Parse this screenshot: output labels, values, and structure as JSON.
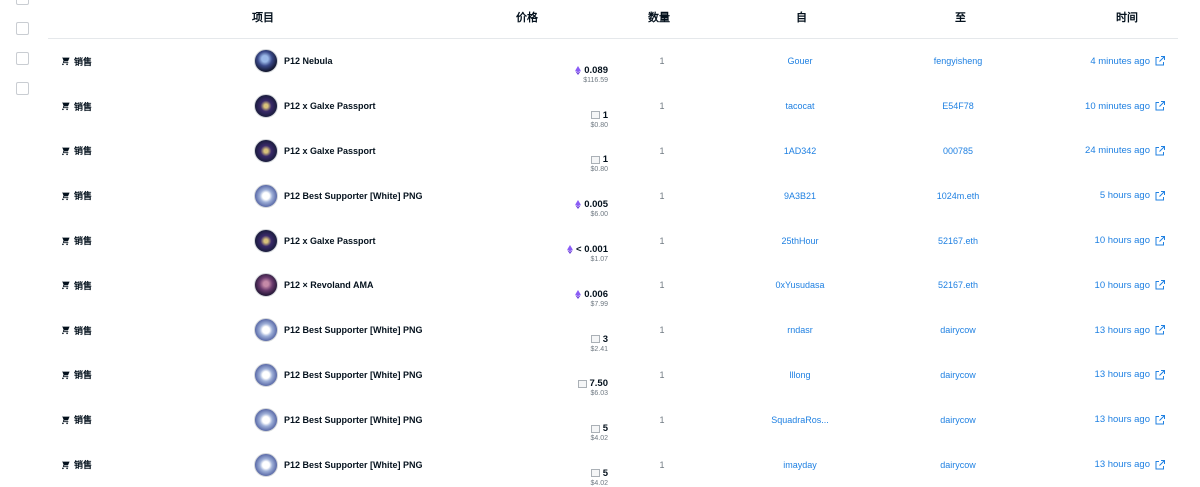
{
  "header": {
    "item": "项目",
    "price": "价格",
    "quantity": "数量",
    "from": "自",
    "to": "至",
    "time": "时间"
  },
  "colors": {
    "link": "#2081e2",
    "muted": "#707a83",
    "text": "#04111d",
    "eth": "#8a5cf6"
  },
  "rows": [
    {
      "event": "销售",
      "item": "P12 Nebula",
      "avatar": "nebula",
      "price_icon": "eth-icon",
      "price": "0.089",
      "usd": "$116.59",
      "qty": "1",
      "from": "Gouer",
      "to": "fengyisheng",
      "time": "4 minutes ago"
    },
    {
      "event": "销售",
      "item": "P12 x Galxe Passport",
      "avatar": "galxe",
      "price_icon": "broken-image-icon",
      "price": "1",
      "usd": "$0.80",
      "qty": "1",
      "from": "tacocat",
      "to": "E54F78",
      "time": "10 minutes ago"
    },
    {
      "event": "销售",
      "item": "P12 x Galxe Passport",
      "avatar": "galxe",
      "price_icon": "broken-image-icon",
      "price": "1",
      "usd": "$0.80",
      "qty": "1",
      "from": "1AD342",
      "to": "000785",
      "time": "24 minutes ago"
    },
    {
      "event": "销售",
      "item": "P12 Best Supporter [White] PNG",
      "avatar": "best",
      "price_icon": "eth-icon",
      "price": "0.005",
      "usd": "$6.00",
      "qty": "1",
      "from": "9A3B21",
      "to": "1024m.eth",
      "time": "5 hours ago"
    },
    {
      "event": "销售",
      "item": "P12 x Galxe Passport",
      "avatar": "galxe",
      "price_icon": "eth-icon",
      "price": "< 0.001",
      "usd": "$1.07",
      "qty": "1",
      "from": "25thHour",
      "to": "52167.eth",
      "time": "10 hours ago"
    },
    {
      "event": "销售",
      "item": "P12 × Revoland AMA",
      "avatar": "revo",
      "price_icon": "eth-icon",
      "price": "0.006",
      "usd": "$7.99",
      "qty": "1",
      "from": "0xYusudasa",
      "to": "52167.eth",
      "time": "10 hours ago"
    },
    {
      "event": "销售",
      "item": "P12 Best Supporter [White] PNG",
      "avatar": "best",
      "price_icon": "broken-image-icon",
      "price": "3",
      "usd": "$2.41",
      "qty": "1",
      "from": "rndasr",
      "to": "dairycow",
      "time": "13 hours ago"
    },
    {
      "event": "销售",
      "item": "P12 Best Supporter [White] PNG",
      "avatar": "best",
      "price_icon": "broken-image-icon",
      "price": "7.50",
      "usd": "$6.03",
      "qty": "1",
      "from": "lllong",
      "to": "dairycow",
      "time": "13 hours ago"
    },
    {
      "event": "销售",
      "item": "P12 Best Supporter [White] PNG",
      "avatar": "best",
      "price_icon": "broken-image-icon",
      "price": "5",
      "usd": "$4.02",
      "qty": "1",
      "from": "SquadraRos...",
      "to": "dairycow",
      "time": "13 hours ago"
    },
    {
      "event": "销售",
      "item": "P12 Best Supporter [White] PNG",
      "avatar": "best",
      "price_icon": "broken-image-icon",
      "price": "5",
      "usd": "$4.02",
      "qty": "1",
      "from": "imayday",
      "to": "dairycow",
      "time": "13 hours ago"
    }
  ]
}
